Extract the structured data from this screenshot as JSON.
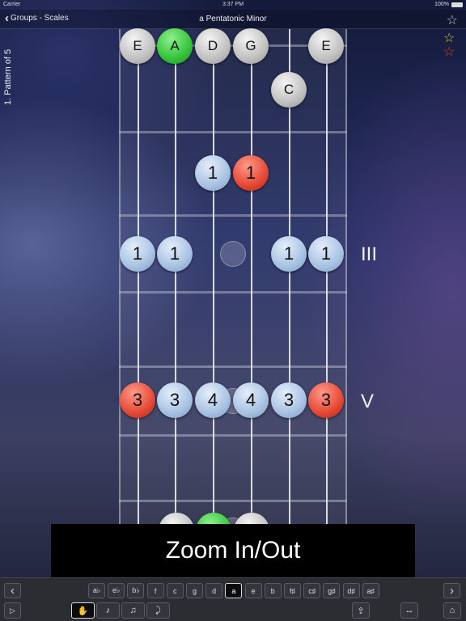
{
  "status": {
    "carrier": "Carrier",
    "time": "3:37 PM",
    "battery": "100%"
  },
  "nav": {
    "back_label": "Groups - Scales",
    "title": "a Pentatonic Minor",
    "favorite_icon": "star-outline-icon"
  },
  "side": {
    "pattern_label": "1. Pattern of 5",
    "star_gold": "#e8c040",
    "star_red": "#e43a2a"
  },
  "strings": [
    {
      "open": "E",
      "open_color": "grey"
    },
    {
      "open": "A",
      "open_color": "green"
    },
    {
      "open": "D",
      "open_color": "grey"
    },
    {
      "open": "G",
      "open_color": "grey"
    },
    {
      "open": "",
      "open_color": ""
    },
    {
      "open": "E",
      "open_color": "grey"
    }
  ],
  "notes": [
    {
      "label": "C",
      "string": 5,
      "row": "fret1",
      "color": "grey"
    },
    {
      "label": "1",
      "string": 3,
      "row": "fret2",
      "color": "blue"
    },
    {
      "label": "1",
      "string": 4,
      "row": "fret2",
      "color": "red"
    },
    {
      "label": "1",
      "string": 1,
      "row": "fret3",
      "color": "blue"
    },
    {
      "label": "1",
      "string": 2,
      "row": "fret3",
      "color": "blue"
    },
    {
      "label": "1",
      "string": 5,
      "row": "fret3",
      "color": "blue"
    },
    {
      "label": "1",
      "string": 6,
      "row": "fret3",
      "color": "blue"
    },
    {
      "label": "3",
      "string": 1,
      "row": "fret5",
      "color": "red"
    },
    {
      "label": "3",
      "string": 2,
      "row": "fret5",
      "color": "blue"
    },
    {
      "label": "4",
      "string": 3,
      "row": "fret5",
      "color": "blue"
    },
    {
      "label": "4",
      "string": 4,
      "row": "fret5",
      "color": "blue"
    },
    {
      "label": "3",
      "string": 5,
      "row": "fret5",
      "color": "blue"
    },
    {
      "label": "3",
      "string": 6,
      "row": "fret5",
      "color": "red"
    }
  ],
  "fret_markers": [
    {
      "label": "III",
      "row": "fret3"
    },
    {
      "label": "V",
      "row": "fret5"
    }
  ],
  "overlay_text": "Zoom In/Out",
  "toolbar": {
    "prev_icon": "chevron-left-icon",
    "next_icon": "chevron-right-icon",
    "play_icon": "play-icon",
    "keys": [
      "a♭",
      "e♭",
      "b♭",
      "f",
      "c",
      "g",
      "d",
      "a",
      "e",
      "b",
      "f♯",
      "c♯",
      "g♯",
      "d♯",
      "a♯"
    ],
    "selected_key": "a",
    "modes": [
      "✋",
      "♪",
      "♫",
      "⤸"
    ],
    "share_icon": "share-icon",
    "swap_icon": "swap-horizontal-icon",
    "lock_icon": "lock-icon"
  },
  "colors": {
    "accent_red": "#e54934",
    "accent_green": "#33c43a",
    "note_blue": "#a8c2e2",
    "note_grey": "#bcbcbc"
  }
}
